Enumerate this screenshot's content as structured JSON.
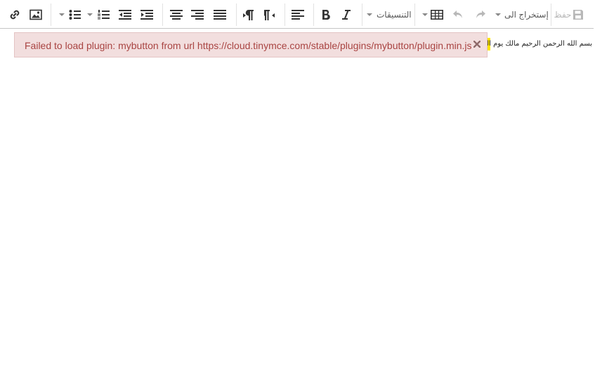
{
  "toolbar": {
    "save_label": "حفظ",
    "insert_dropdown_label": "إستخراج الى",
    "formats_label": "التنسيقات"
  },
  "editor": {
    "content_text": "بسم الله الرحمن الرحيم مالك يوم الدين"
  },
  "notification": {
    "message": "Failed to load plugin: mybutton from url https://cloud.tinymce.com/stable/plugins/mybutton/plugin.min.js",
    "close_icon": "close-icon",
    "colors": {
      "background": "#f2dede",
      "text": "#a94442",
      "border": "#e4c4c4"
    }
  },
  "icons": [
    "link-icon",
    "image-icon",
    "bullet-list-icon",
    "numbered-list-icon",
    "outdent-icon",
    "indent-icon",
    "align-center-icon",
    "align-right-icon",
    "align-justify-icon",
    "ltr-icon",
    "rtl-icon",
    "align-left-icon",
    "bold-icon",
    "italic-icon",
    "table-icon",
    "undo-icon",
    "redo-icon",
    "save-icon"
  ]
}
